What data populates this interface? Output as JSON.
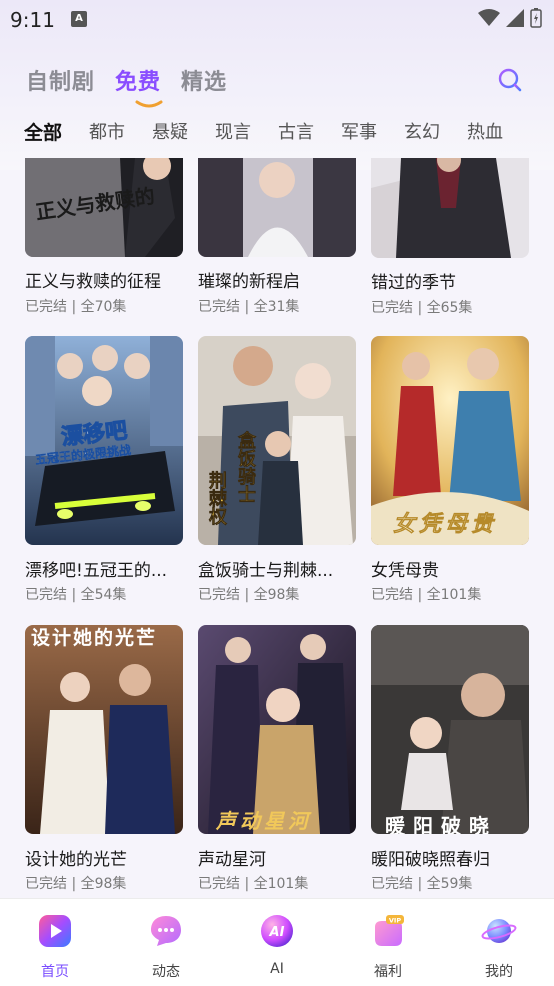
{
  "status_bar": {
    "time": "9:11",
    "notification_icon": "A"
  },
  "top_tabs": [
    {
      "label": "自制剧",
      "active": false
    },
    {
      "label": "免费",
      "active": true
    },
    {
      "label": "精选",
      "active": false
    }
  ],
  "categories": [
    "全部",
    "都市",
    "悬疑",
    "现言",
    "古言",
    "军事",
    "玄幻",
    "热血"
  ],
  "dramas": [
    {
      "title": "正义与救赎的征程",
      "meta": "已完结 | 全70集",
      "poster_text": "正义与救赎的",
      "palette": [
        "#6b6a70",
        "#2b2b30"
      ]
    },
    {
      "title": "璀璨的新程启",
      "meta": "已完结 | 全31集",
      "poster_text": "",
      "palette": [
        "#b8b5c0",
        "#3b3640"
      ]
    },
    {
      "title": "错过的季节",
      "meta": "已完结 | 全65集",
      "poster_text": "",
      "palette": [
        "#e9e6ea",
        "#27262b"
      ]
    },
    {
      "title": "漂移吧!五冠王的...",
      "meta": "已完结 | 全54集",
      "poster_text": "漂移吧",
      "poster_subtext": "五冠王的极限挑战",
      "palette": [
        "#5b7fb0",
        "#1f2d4a"
      ]
    },
    {
      "title": "盒饭骑士与荆棘...",
      "meta": "已完结 | 全98集",
      "poster_text": "盒饭骑士",
      "poster_subtext": "荆棘权",
      "palette": [
        "#c9c2b8",
        "#5b4a3c"
      ]
    },
    {
      "title": "女凭母贵",
      "meta": "已完结 | 全101集",
      "poster_text": "女凭母贵",
      "palette": [
        "#e8c26a",
        "#8a5a2a"
      ]
    },
    {
      "title": "设计她的光芒",
      "meta": "已完结 | 全98集",
      "poster_text": "设计她的光芒",
      "palette": [
        "#8a5a3c",
        "#2a1a14"
      ]
    },
    {
      "title": "声动星河",
      "meta": "已完结 | 全101集",
      "poster_text": "声动星河",
      "palette": [
        "#4a3a5a",
        "#1a1420"
      ]
    },
    {
      "title": "暖阳破晓照春归",
      "meta": "已完结 | 全59集",
      "poster_text": "暖阳破晓",
      "palette": [
        "#5a5654",
        "#1e1c1b"
      ]
    }
  ],
  "bottom_nav": [
    {
      "label": "首页",
      "active": true
    },
    {
      "label": "动态",
      "active": false
    },
    {
      "label": "AI",
      "active": false
    },
    {
      "label": "福利",
      "active": false
    },
    {
      "label": "我的",
      "active": false
    }
  ],
  "colors": {
    "accent": "#8a4dff",
    "inactive_text": "#8c8c94"
  }
}
